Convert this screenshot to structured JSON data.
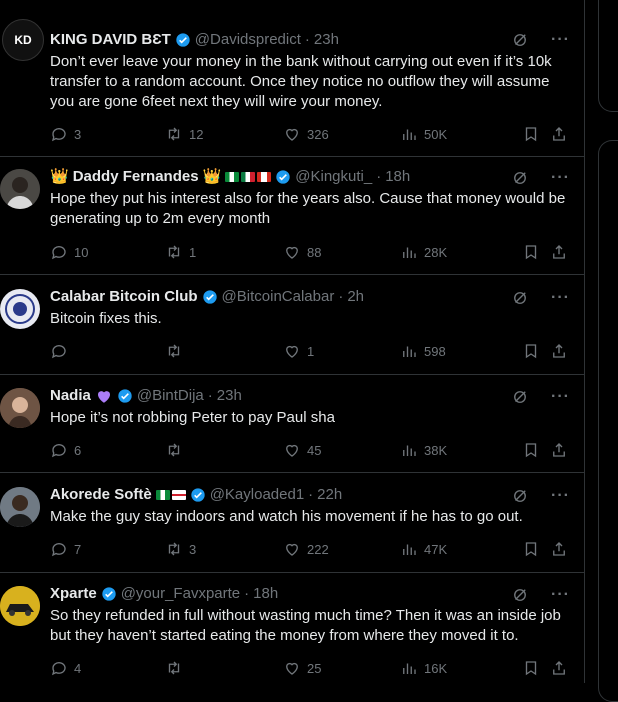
{
  "tweets": [
    {
      "name": "KING DAVID BƐT",
      "handle": "@Davidspredict",
      "time": "23h",
      "avatar_text": "KD",
      "avatar_color": "#111111",
      "text": "Don’t ever leave your money in the bank without carrying out even if it’s 10k transfer to a random account. Once they notice no outflow they will assume you are gone 6feet next they will wire your money.",
      "replies": "3",
      "reposts": "12",
      "likes": "326",
      "views": "50K"
    },
    {
      "name": "Daddy Fernandes",
      "name_prefix": "👑",
      "name_suffix": "👑",
      "handle": "@Kingkuti_",
      "time": "18h",
      "avatar_text": "",
      "avatar_color": "#3a3a3a",
      "text": "Hope they put his interest also for the years also. Cause that money would be generating up to 2m every month",
      "replies": "10",
      "reposts": "1",
      "likes": "88",
      "views": "28K"
    },
    {
      "name": "Calabar Bitcoin Club",
      "handle": "@BitcoinCalabar",
      "time": "2h",
      "avatar_text": "",
      "avatar_color": "#e8eaf2",
      "text": "Bitcoin fixes this.",
      "replies": "",
      "reposts": "",
      "likes": "1",
      "views": "598"
    },
    {
      "name": "Nadia",
      "handle": "@BintDija",
      "time": "23h",
      "avatar_text": "",
      "avatar_color": "#8a6a55",
      "text": "Hope it’s not robbing Peter to pay Paul sha",
      "replies": "6",
      "reposts": "",
      "likes": "45",
      "views": "38K"
    },
    {
      "name": "Akorede Softè",
      "handle": "@Kayloaded1",
      "time": "22h",
      "avatar_text": "",
      "avatar_color": "#5a6470",
      "text": "Make the guy stay indoors and watch his movement if he has to go out.",
      "replies": "7",
      "reposts": "3",
      "likes": "222",
      "views": "47K"
    },
    {
      "name": "Xparte",
      "handle": "@your_Favxparte",
      "time": "18h",
      "avatar_text": "",
      "avatar_color": "#c9a21a",
      "text": "So they refunded in full without wasting much time? Then it was an inside job but they haven’t started eating the money from where they moved it to.",
      "replies": "4",
      "reposts": "",
      "likes": "25",
      "views": "16K"
    }
  ],
  "separator": "·",
  "colors": {
    "verified": "#1d9bf0",
    "purple_heart": "#ab7df8",
    "muted": "#71767b"
  }
}
